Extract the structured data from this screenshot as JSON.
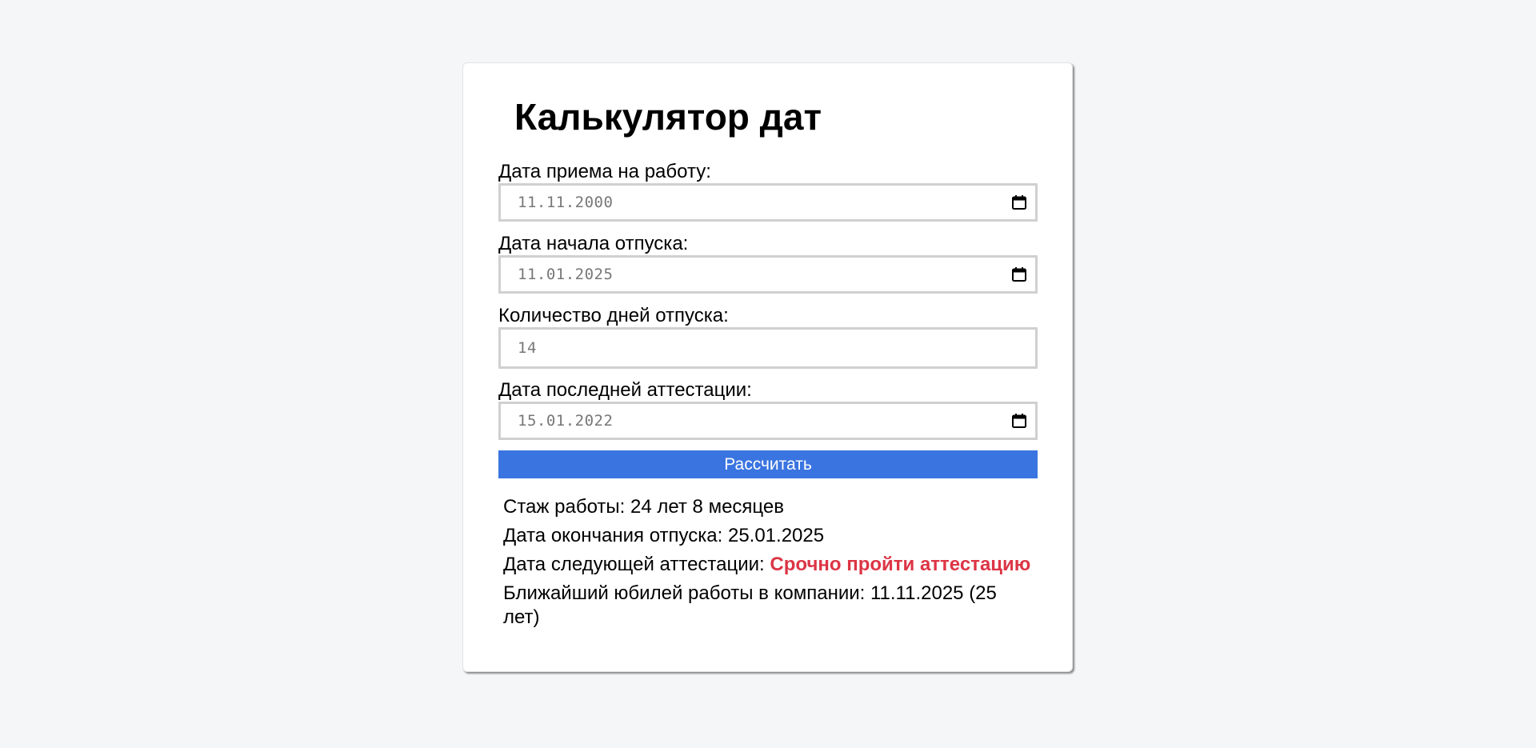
{
  "page": {
    "title": "Калькулятор дат"
  },
  "form": {
    "hire_date": {
      "label": "Дата приема на работу:",
      "value": "11.11.2000"
    },
    "vacation_start": {
      "label": "Дата начала отпуска:",
      "value": "11.01.2025"
    },
    "vacation_days": {
      "label": "Количество дней отпуска:",
      "value": "14"
    },
    "last_attestation": {
      "label": "Дата последней аттестации:",
      "value": "15.01.2022"
    },
    "submit_label": "Рассчитать"
  },
  "results": {
    "experience_label": "Стаж работы:",
    "experience_value": "24 лет 8 месяцев",
    "vacation_end_label": "Дата окончания отпуска:",
    "vacation_end_value": "25.01.2025",
    "next_attestation_label": "Дата следующей аттестации:",
    "next_attestation_value": "Срочно пройти аттестацию",
    "anniversary_label": "Ближайший юбилей работы в компании:",
    "anniversary_value": "11.11.2025 (25 лет)"
  },
  "colors": {
    "button": "#3a74e0",
    "urgent": "#dc3545",
    "background": "#f5f6f8"
  },
  "icons": {
    "date_picker": "calendar-icon"
  }
}
